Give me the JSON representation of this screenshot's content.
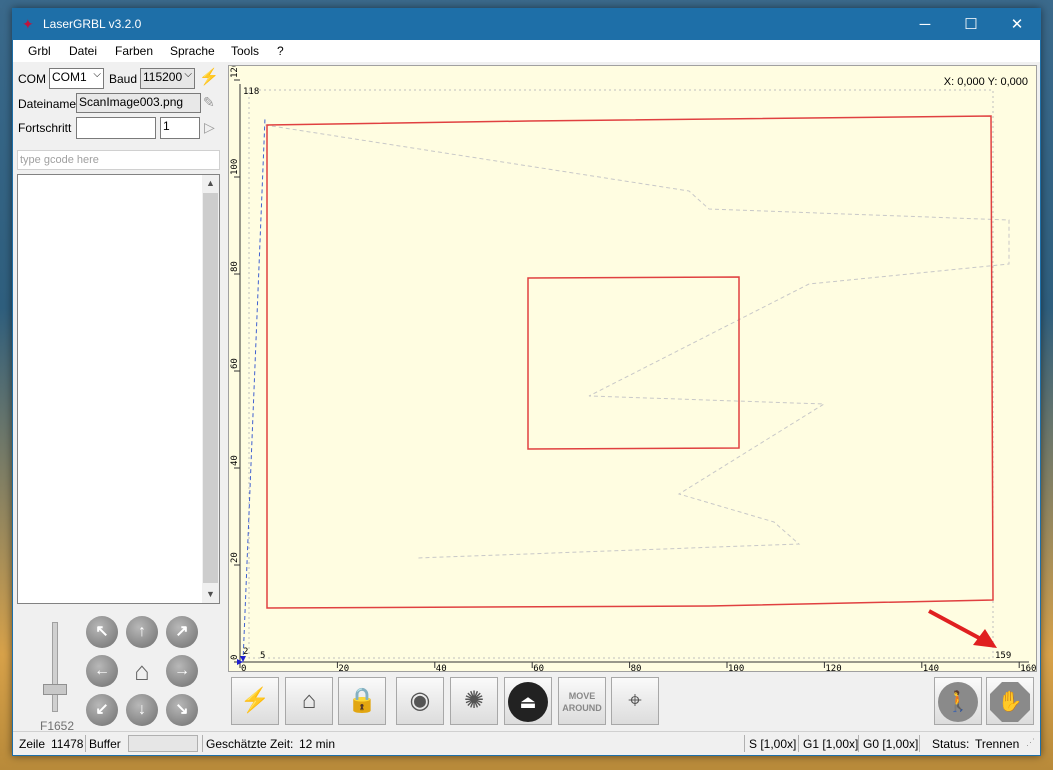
{
  "window": {
    "title": "LaserGRBL v3.2.0",
    "minimize": "─",
    "maximize": "☐",
    "close": "✕"
  },
  "menu": [
    "Grbl",
    "Datei",
    "Farben",
    "Sprache",
    "Tools",
    "?"
  ],
  "connection": {
    "com_label": "COM",
    "com_value": "COM1",
    "baud_label": "Baud",
    "baud_value": "115200"
  },
  "file": {
    "label": "Dateiname",
    "value": "ScanImage003.png"
  },
  "progress": {
    "label": "Fortschritt",
    "count": "1"
  },
  "gcode_input": {
    "placeholder": "type gcode here"
  },
  "speed": {
    "label": "F1652"
  },
  "canvas": {
    "coords": "X: 0,000 Y: 0,000",
    "x_ticks": [
      "0",
      "20",
      "40",
      "60",
      "80",
      "100",
      "120",
      "140",
      "160"
    ],
    "y_ticks": [
      "0",
      "20",
      "40",
      "60",
      "80",
      "100",
      "120"
    ],
    "top_left_label": "118",
    "bottom_labels": [
      "2",
      "5",
      "159"
    ]
  },
  "toolbar": {
    "icons": [
      "lightning-icon",
      "home-search-icon",
      "padlock-icon",
      "globe-pin-icon",
      "laser-burst-icon",
      "eject-icon",
      "move-around-icon",
      "crosshair-icon"
    ],
    "move_text": "MOVE",
    "around_text": "AROUND",
    "right_icons": [
      "walking-person-icon",
      "stop-hand-icon"
    ]
  },
  "status": {
    "line_label": "Zeile",
    "line_value": "11478",
    "buffer_label": "Buffer",
    "time_label": "Geschätzte Zeit:",
    "time_value": "12 min",
    "s": "S [1,00x]",
    "g1": "G1 [1,00x]",
    "g0": "G0 [1,00x]",
    "state_label": "Status:",
    "state_value": "Trennen"
  },
  "colors": {
    "titlebar": "#1e6fa8",
    "canvas_bg": "#fffde1",
    "path": "#e04040",
    "rapid": "#b8b8b8"
  }
}
